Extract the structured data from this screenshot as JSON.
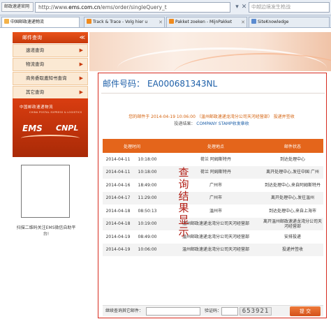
{
  "browser": {
    "pinned_tab": "邮政速递官网",
    "url_prefix": "http://www.",
    "url_host": "ems.com.cn",
    "url_path": "/ems/order/singleQuery_t",
    "search_placeholder": "中越边境发生枪战",
    "tabs": [
      {
        "label": "中国邮政速递物流"
      },
      {
        "label": "Track & Trace - Volg hier u"
      },
      {
        "label": "Pakket zoeken - MijnPakket"
      },
      {
        "label": "SiteKnowledge"
      }
    ]
  },
  "sidebar": {
    "header": "邮件查询",
    "items": [
      {
        "label": "速递查询"
      },
      {
        "label": "物流查询"
      },
      {
        "label": "商务委取邀知书查询"
      },
      {
        "label": "其它查询"
      }
    ]
  },
  "logo": {
    "cn": "中国邮政速递物流",
    "en": "CHINA POSTAL EXPRESS & LOGISTICS",
    "ems": "EMS",
    "cnpl": "CNPL"
  },
  "qr_caption": "扫描二维码关注EMS微信自助平台!",
  "result": {
    "label": "邮件号码：",
    "number": "EA000681343NL",
    "summary_prefix": "您的邮件于",
    "summary_time": "2014-04-19 10:06:00",
    "summary_loc": "（温州邮政速递龙湾分公司天河经营部）",
    "summary_action": "投递并签收",
    "summary_label2": "投递结果：",
    "summary_result": "COMPANY STAMP收发章收",
    "overlay": "查询结果显示",
    "columns": [
      "处理时间",
      "处理地点",
      "邮件状态"
    ],
    "rows": [
      {
        "date": "2014-04-11",
        "time": "10:18:00",
        "location": "荷兰 阿姆斯特丹",
        "status": "到达处理中心"
      },
      {
        "date": "2014-04-11",
        "time": "10:18:00",
        "location": "荷兰 阿姆斯特丹",
        "status": "离开处理中心,发往中国 广州"
      },
      {
        "date": "2014-04-16",
        "time": "18:49:00",
        "location": "广州市",
        "status": "到达处理中心,来自阿姆斯特丹"
      },
      {
        "date": "2014-04-17",
        "time": "11:29:00",
        "location": "广州市",
        "status": "离开处理中心,发往温州"
      },
      {
        "date": "2014-04-18",
        "time": "08:50:13",
        "location": "温州市",
        "status": "到达处理中心,来自上海市"
      },
      {
        "date": "2014-04-18",
        "time": "10:19:00",
        "location": "温州邮政速递龙湾分公司天河经营部",
        "status": "离开温州邮政速递龙湾分公司天河经营部"
      },
      {
        "date": "2014-04-19",
        "time": "08:49:00",
        "location": "温州邮政速递龙湾分公司天河经营部",
        "status": "安排投递"
      },
      {
        "date": "2014-04-19",
        "time": "10:06:00",
        "location": "温州邮政速递龙湾分公司天河经营部",
        "status": "投递并签收"
      }
    ]
  },
  "bottom": {
    "continue_label": "继续查询其它邮件：",
    "captcha_label": "验证码：",
    "captcha_value": "653921",
    "submit_label": "提 交"
  },
  "colors": {
    "accent": "#e4651b",
    "frame": "#d72a1e",
    "link": "#1d5fa8"
  }
}
